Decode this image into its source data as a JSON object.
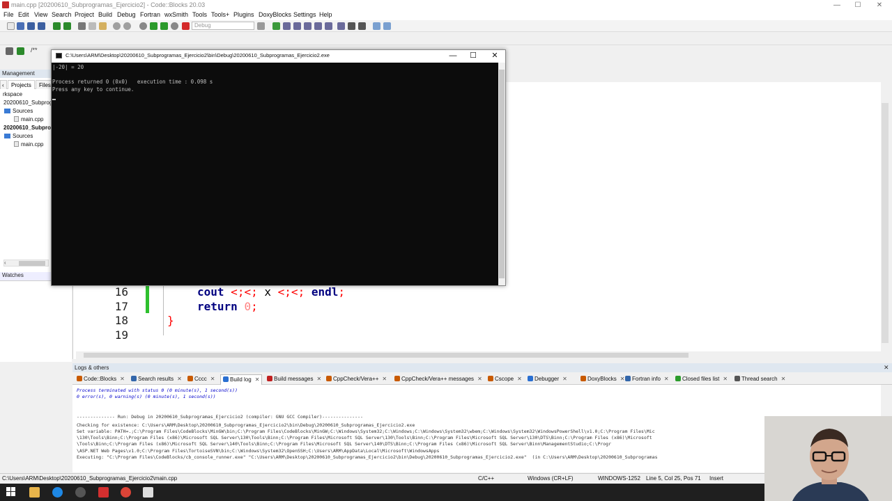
{
  "window": {
    "title": "main.cpp [20200610_Subprogramas_Ejercicio2] - Code::Blocks 20.03",
    "min": "—",
    "max": "☐",
    "close": "✕"
  },
  "menu": [
    "File",
    "Edit",
    "View",
    "Search",
    "Project",
    "Build",
    "Debug",
    "Fortran",
    "wxSmith",
    "Tools",
    "Tools+",
    "Plugins",
    "DoxyBlocks",
    "Settings",
    "Help"
  ],
  "toolbar": {
    "build_target": "Debug"
  },
  "management": {
    "header": "Management",
    "tabs": [
      "Projects",
      "Files"
    ],
    "tree": [
      {
        "label": "rkspace",
        "kind": "text"
      },
      {
        "label": "20200610_Subprogra",
        "kind": "text"
      },
      {
        "label": "Sources",
        "kind": "folder"
      },
      {
        "label": "main.cpp",
        "kind": "file"
      },
      {
        "label": "20200610_Subprogr",
        "kind": "bold"
      },
      {
        "label": "Sources",
        "kind": "folder"
      },
      {
        "label": "main.cpp",
        "kind": "file"
      }
    ],
    "watches_header": "Watches"
  },
  "editor": {
    "lines": [
      {
        "no": "16",
        "code": "cout << x << endl;"
      },
      {
        "no": "17",
        "code": "return 0;"
      },
      {
        "no": "18",
        "code": "}"
      },
      {
        "no": "19",
        "code": ""
      }
    ]
  },
  "console": {
    "title": "C:\\Users\\ARM\\Desktop\\20200610_Subprogramas_Ejercicio2\\bin\\Debug\\20200610_Subprogramas_Ejercicio2.exe",
    "lines": [
      "|-20| = 20",
      "",
      "Process returned 0 (0x0)   execution time : 0.098 s",
      "Press any key to continue."
    ]
  },
  "logs": {
    "header": "Logs & others",
    "tabs": [
      {
        "label": "Code::Blocks",
        "color": "#c85a00"
      },
      {
        "label": "Search results",
        "color": "#3366aa"
      },
      {
        "label": "Cccc",
        "color": "#c85a00"
      },
      {
        "label": "Build log",
        "color": "#2a6fd1",
        "active": true
      },
      {
        "label": "Build messages",
        "color": "#c02020"
      },
      {
        "label": "CppCheck/Vera++",
        "color": "#c85a00"
      },
      {
        "label": "CppCheck/Vera++ messages",
        "color": "#c85a00"
      },
      {
        "label": "Cscope",
        "color": "#c85a00"
      },
      {
        "label": "Debugger",
        "color": "#2a6fd1"
      },
      {
        "label": "DoxyBlocks",
        "color": "#c85a00"
      },
      {
        "label": "Fortran info",
        "color": "#3366aa"
      },
      {
        "label": "Closed files list",
        "color": "#2c9c2c"
      },
      {
        "label": "Thread search",
        "color": "#555555"
      }
    ],
    "lines": [
      "Process terminated with status 0 (0 minute(s), 1 second(s))",
      "0 error(s), 0 warning(s) (0 minute(s), 1 second(s))",
      "",
      "",
      "-------------- Run: Debug in 20200610_Subprogramas_Ejercicio2 (compiler: GNU GCC Compiler)---------------",
      "Checking for existence: C:\\Users\\ARM\\Desktop\\20200610_Subprogramas_Ejercicio2\\bin\\Debug\\20200610_Subprogramas_Ejercicio2.exe",
      "Set variable: PATH=.;C:\\Program Files\\CodeBlocks\\MinGW\\bin;C:\\Program Files\\CodeBlocks\\MinGW;C:\\Windows\\System32;C:\\Windows;C:\\Windows\\System32\\wbem;C:\\Windows\\System32\\WindowsPowerShell\\v1.0;C:\\Program Files\\Mic",
      "\\130\\Tools\\Binn;C:\\Program Files (x86)\\Microsoft SQL Server\\130\\Tools\\Binn;C:\\Program Files\\Microsoft SQL Server\\130\\Tools\\Binn;C:\\Program Files\\Microsoft SQL Server\\130\\DTS\\Binn;C:\\Program Files (x86)\\Microsoft",
      "\\Tools\\Binn;C:\\Program Files (x86)\\Microsoft SQL Server\\140\\Tools\\Binn;C:\\Program Files\\Microsoft SQL Server\\140\\DTS\\Binn;C:\\Program Files (x86)\\Microsoft SQL Server\\Binn\\ManagementStudio;C:\\Progr",
      "\\ASP.NET Web Pages\\v1.0;C:\\Program Files\\TortoiseSVN\\bin;C:\\Windows\\System32\\OpenSSH;C:\\Users\\ARM\\AppData\\Local\\Microsoft\\WindowsApps",
      "Executing: \"C:\\Program Files\\CodeBlocks/cb_console_runner.exe\" \"C:\\Users\\ARM\\Desktop\\20200610_Subprogramas_Ejercicio2\\bin\\Debug\\20200610_Subprogramas_Ejercicio2.exe\"  (in C:\\Users\\ARM\\Desktop\\20200610_Subprogramas"
    ]
  },
  "status": {
    "path": "C:\\Users\\ARM\\Desktop\\20200610_Subprogramas_Ejercicio2\\main.cpp",
    "lang": "C/C++",
    "eol": "Windows (CR+LF)",
    "encoding": "WINDOWS-1252",
    "position": "Line 5, Col 25, Pos 71",
    "mode": "Insert"
  }
}
